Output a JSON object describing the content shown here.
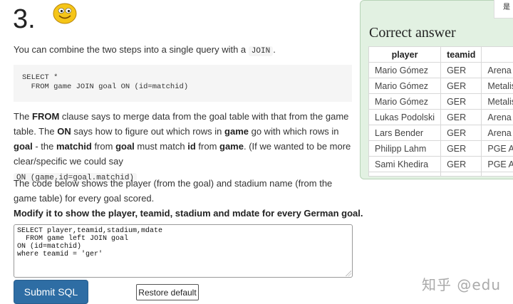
{
  "heading": "3.",
  "intro": {
    "text": "You can combine the two steps into a single query with a",
    "code": "JOIN",
    "end": "."
  },
  "codeblock": "SELECT *\n  FROM game JOIN goal ON (id=matchid)",
  "para1": {
    "t1": "The ",
    "b1": "FROM",
    "t2": " clause says to merge data from the goal table with that from the game table. The ",
    "b2": "ON",
    "t3": " says how to figure out which rows in ",
    "b3": "game",
    "t4": " go with which rows in ",
    "b4": "goal",
    "t5": " - the ",
    "b5": "matchid",
    "t6": " from ",
    "b6": "goal",
    "t7": " must match ",
    "b7": "id",
    "t8": " from ",
    "b8": "game",
    "t9": ". (If we wanted to be more clear/specific we could say",
    "code": "ON (game.id=goal.matchid)"
  },
  "para2": "The code below shows the player (from the goal) and stadium name (from the game table) for every goal scored.",
  "instruction": "Modify it to show the player, teamid, stadium and mdate for every German goal.",
  "editor_value": "SELECT player,teamid,stadium,mdate\n  FROM game left JOIN goal\nON (id=matchid)\nwhere teamid = 'ger'",
  "buttons": {
    "submit": "Submit SQL",
    "restore": "Restore default"
  },
  "answer": {
    "title": "Correct answer",
    "corner": "是",
    "headers": [
      "player",
      "teamid",
      ""
    ],
    "rows": [
      [
        "Mario Gómez",
        "GER",
        "Arena Lv"
      ],
      [
        "Mario Gómez",
        "GER",
        "Metalist"
      ],
      [
        "Mario Gómez",
        "GER",
        "Metalist"
      ],
      [
        "Lukas Podolski",
        "GER",
        "Arena Lv"
      ],
      [
        "Lars Bender",
        "GER",
        "Arena Lv"
      ],
      [
        "Philipp Lahm",
        "GER",
        "PGE Are"
      ],
      [
        "Sami Khedira",
        "GER",
        "PGE Are"
      ]
    ]
  },
  "watermark": "知乎 @edu",
  "colors": {
    "submit_bg": "#2e6da4",
    "panel_bg": "#e2f1e2",
    "smiley": "#f5c518"
  },
  "icons": {
    "smiley": "smiley-face-icon"
  }
}
